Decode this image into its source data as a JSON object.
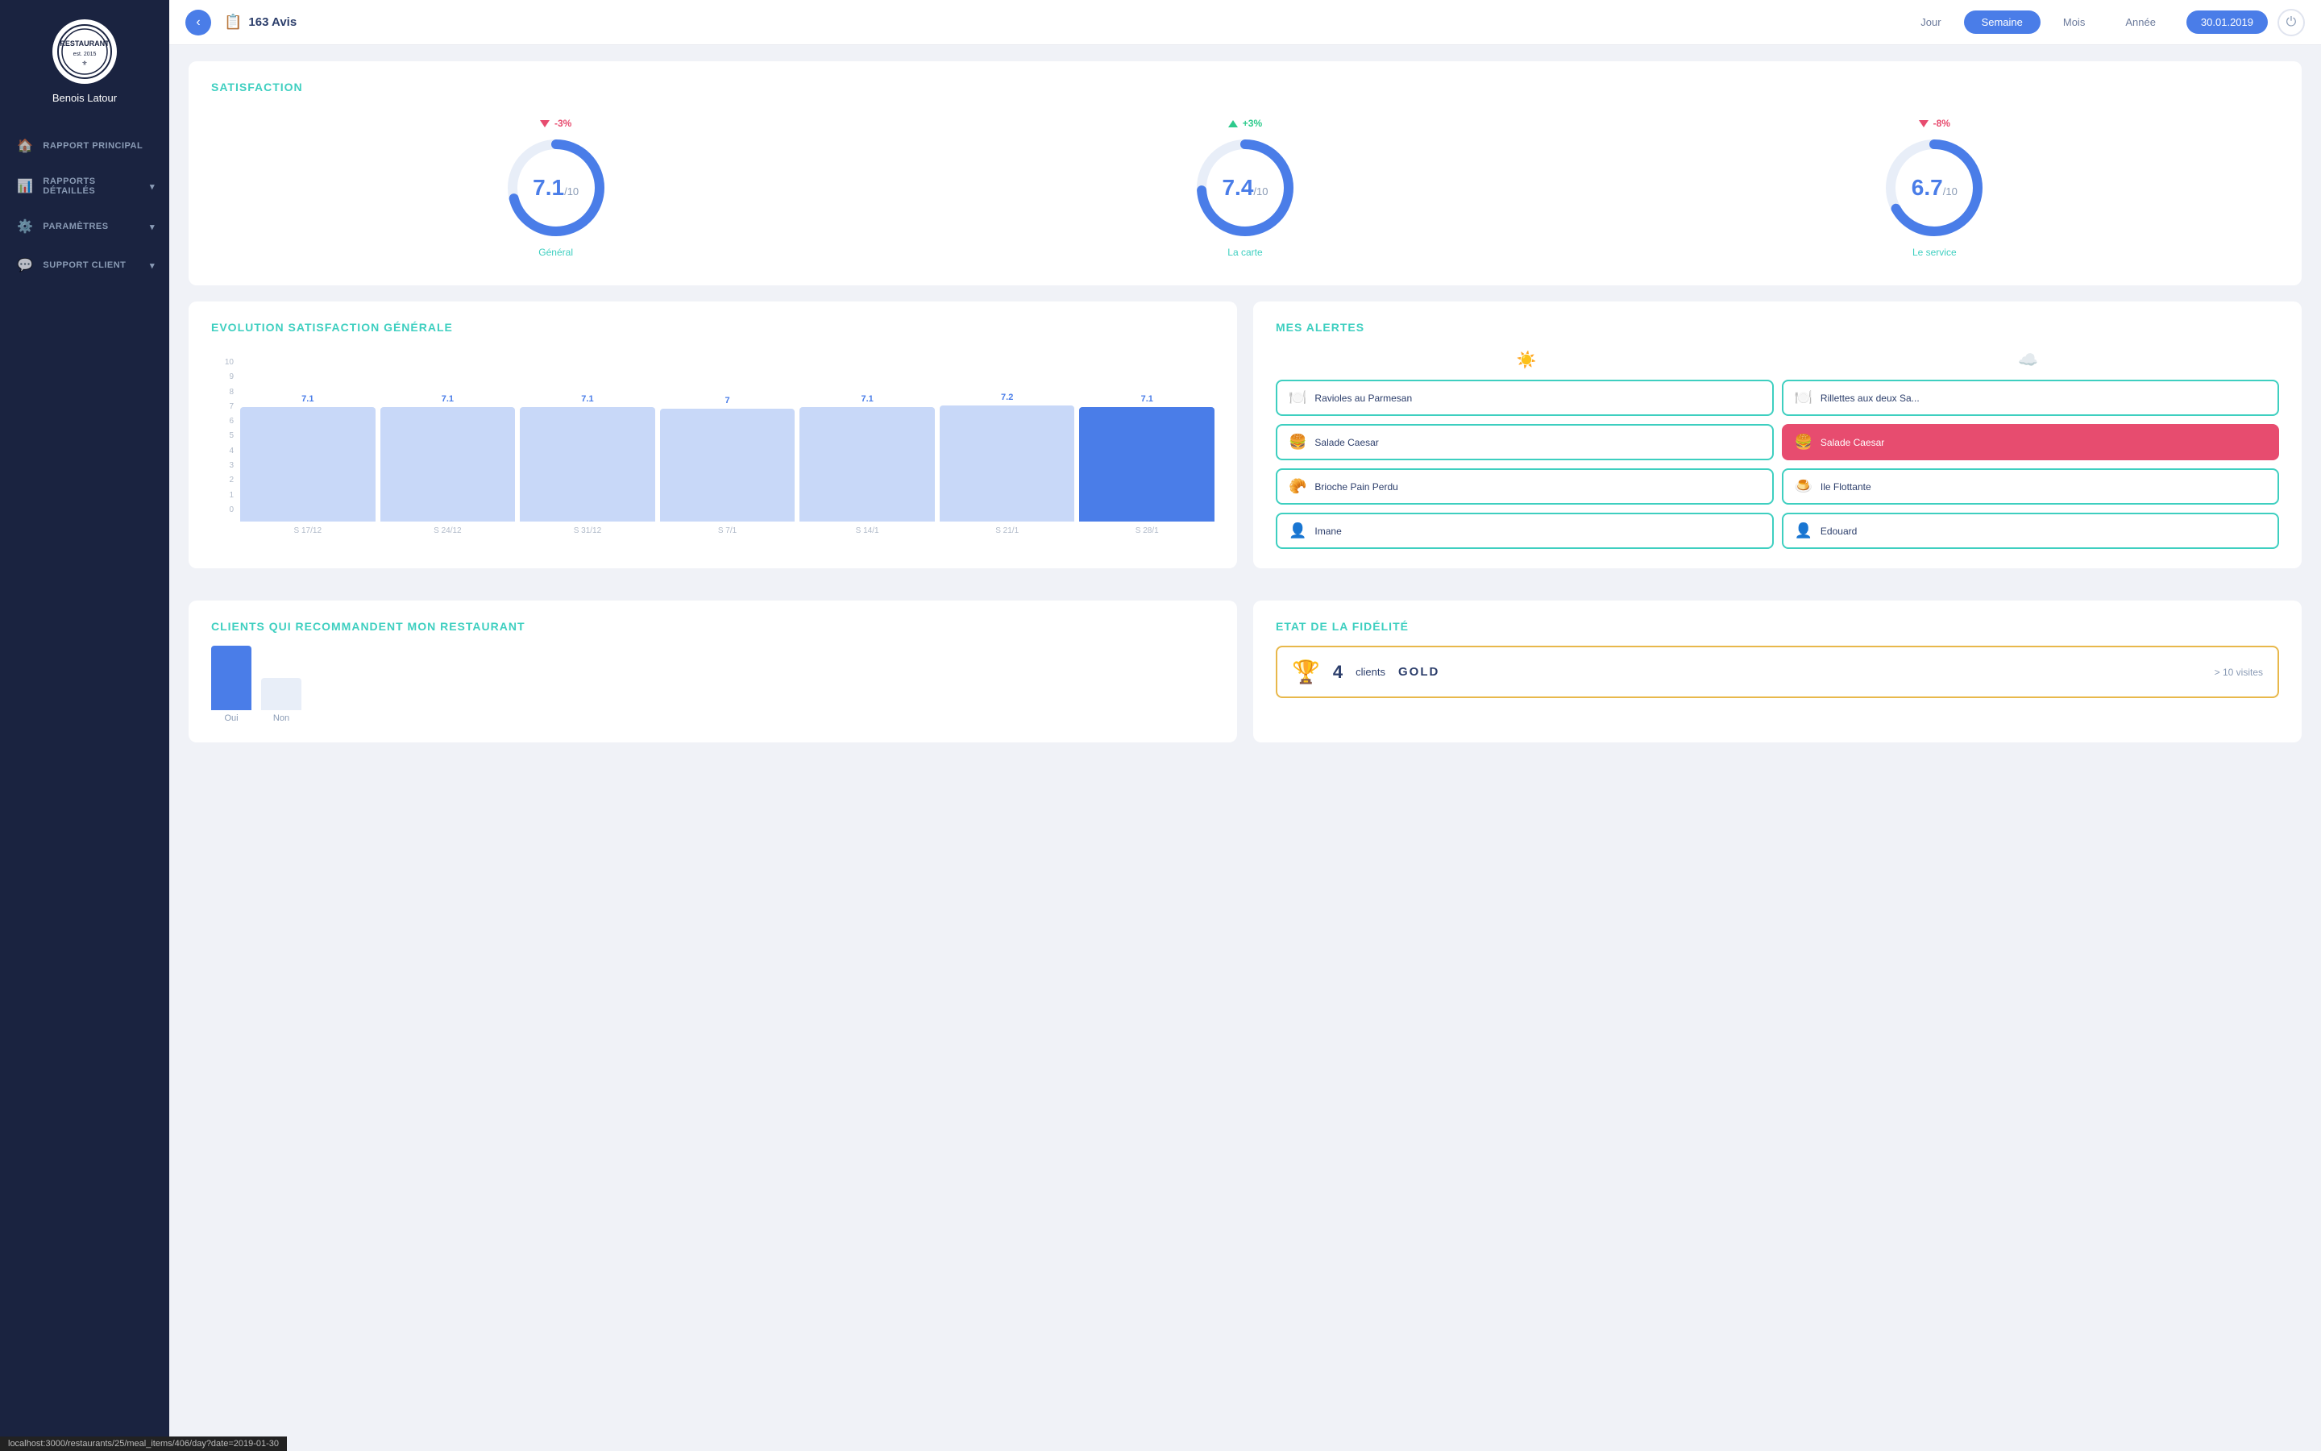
{
  "sidebar": {
    "username": "Benois Latour",
    "items": [
      {
        "id": "rapport-principal",
        "label": "RAPPORT PRINCIPAL",
        "icon": "🏠",
        "hasChevron": false
      },
      {
        "id": "rapports-detailles",
        "label": "RAPPORTS DÉTAILLÉS",
        "icon": "📊",
        "hasChevron": true
      },
      {
        "id": "parametres",
        "label": "PARAMÈTRES",
        "icon": "⚙️",
        "hasChevron": true
      },
      {
        "id": "support-client",
        "label": "SUPPORT CLIENT",
        "icon": "💬",
        "hasChevron": true
      }
    ]
  },
  "header": {
    "back_label": "‹",
    "reviews_count": "163 Avis",
    "tabs": [
      {
        "id": "jour",
        "label": "Jour",
        "active": false
      },
      {
        "id": "semaine",
        "label": "Semaine",
        "active": true
      },
      {
        "id": "mois",
        "label": "Mois",
        "active": false
      },
      {
        "id": "annee",
        "label": "Année",
        "active": false
      }
    ],
    "date": "30.01.2019"
  },
  "satisfaction": {
    "title": "SATISFACTION",
    "items": [
      {
        "id": "general",
        "value": "7.1",
        "max": "/10",
        "label": "Général",
        "change": "-3%",
        "direction": "down",
        "percent": 71
      },
      {
        "id": "la-carte",
        "value": "7.4",
        "max": "/10",
        "label": "La carte",
        "change": "+3%",
        "direction": "up",
        "percent": 74
      },
      {
        "id": "le-service",
        "value": "6.7",
        "max": "/10",
        "label": "Le service",
        "change": "-8%",
        "direction": "down",
        "percent": 67
      }
    ]
  },
  "evolution": {
    "title": "EVOLUTION SATISFACTION GÉNÉRALE",
    "y_labels": [
      "0",
      "1",
      "2",
      "3",
      "4",
      "5",
      "6",
      "7",
      "8",
      "9",
      "10"
    ],
    "bars": [
      {
        "label": "S 17/12",
        "value": "7.1",
        "active": false
      },
      {
        "label": "S 24/12",
        "value": "7.1",
        "active": false
      },
      {
        "label": "S 31/12",
        "value": "7.1",
        "active": false
      },
      {
        "label": "S 7/1",
        "value": "7",
        "active": false
      },
      {
        "label": "S 14/1",
        "value": "7.1",
        "active": false
      },
      {
        "label": "S 21/1",
        "value": "7.2",
        "active": false
      },
      {
        "label": "S 28/1",
        "value": "7.1",
        "active": true
      }
    ]
  },
  "alertes": {
    "title": "MES ALERTES",
    "sun_icon": "☀️",
    "cloud_icon": "☁️",
    "items_left": [
      {
        "id": "ravioles",
        "label": "Ravioles au Parmesan",
        "icon": "🍽️",
        "highlight": false
      },
      {
        "id": "salade-caesar-l",
        "label": "Salade Caesar",
        "icon": "🍔",
        "highlight": false
      },
      {
        "id": "brioche",
        "label": "Brioche Pain Perdu",
        "icon": "🥐",
        "highlight": false
      },
      {
        "id": "imane",
        "label": "Imane",
        "icon": "👤",
        "highlight": false
      }
    ],
    "items_right": [
      {
        "id": "rillettes",
        "label": "Rillettes aux deux Sa...",
        "icon": "🍽️",
        "highlight": false
      },
      {
        "id": "salade-caesar-r",
        "label": "Salade Caesar",
        "icon": "🍔",
        "highlight": true
      },
      {
        "id": "ile-flottante",
        "label": "Ile Flottante",
        "icon": "🍮",
        "highlight": false
      },
      {
        "id": "edouard",
        "label": "Edouard",
        "icon": "👤",
        "highlight": false
      }
    ]
  },
  "recommandent": {
    "title": "CLIENTS QUI RECOMMANDENT MON RESTAURANT",
    "oui_label": "Oui",
    "non_label": "Non"
  },
  "fidelite": {
    "title": "ETAT DE LA FIDÉLITÉ",
    "gold_count": "4",
    "gold_label": "clients",
    "gold_tier": "GOLD",
    "gold_visits": "> 10 visites"
  },
  "statusbar": {
    "url": "localhost:3000/restaurants/25/meal_items/406/day?date=2019-01-30"
  }
}
